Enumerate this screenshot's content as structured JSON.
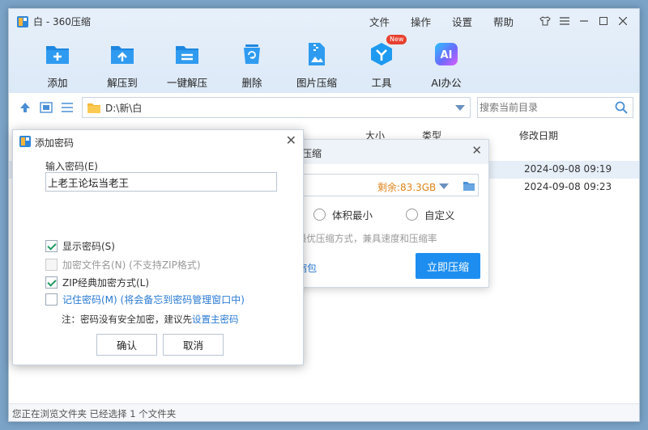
{
  "app": {
    "title": "白 - 360压缩"
  },
  "menu": [
    "文件",
    "操作",
    "设置",
    "帮助"
  ],
  "toolbar": [
    {
      "label": "添加",
      "icon": "add-file-icon"
    },
    {
      "label": "解压到",
      "icon": "extract-to-icon"
    },
    {
      "label": "一键解压",
      "icon": "one-click-extract-icon"
    },
    {
      "label": "删除",
      "icon": "delete-icon"
    },
    {
      "label": "图片压缩",
      "icon": "image-compress-icon"
    },
    {
      "label": "工具",
      "icon": "tools-icon",
      "badge": "New"
    },
    {
      "label": "AI办公",
      "icon": "ai-office-icon",
      "icon_text": "AI"
    }
  ],
  "address": {
    "path": "D:\\新\\白"
  },
  "search": {
    "placeholder": "搜索当前目录"
  },
  "columns": {
    "size": "大小",
    "type": "类型",
    "modified": "修改日期"
  },
  "files": [
    {
      "modified": "2024-09-08 09:19"
    },
    {
      "modified": "2024-09-08 09:23"
    }
  ],
  "status": {
    "text": "您正在浏览文件夹 已经选择 1 个文件夹"
  },
  "compress_dialog": {
    "title_partial": "压缩",
    "free_space": "剩余:83.3GB",
    "option_smallest": "体积最小",
    "option_custom": "自定义",
    "description": "最优压缩方式，兼具速度和压缩率",
    "link_partial": "缩包",
    "start_button": "立即压缩"
  },
  "password_dialog": {
    "title": "添加密码",
    "input_label": "输入密码(E)",
    "password_value": "上老王论坛当老王",
    "show_password": "显示密码(S)",
    "encrypt_filenames": "加密文件名(N) (不支持ZIP格式)",
    "zip_classic": "ZIP经典加密方式(L)",
    "remember_password": "记住密码(M) (将会备忘到密码管理窗口中)",
    "note_prefix": "注：密码没有安全加密，建议先",
    "note_link": "设置主密码",
    "ok": "确认",
    "cancel": "取消"
  },
  "colors": {
    "accent": "#1d8ef0",
    "free_space": "#e0841b",
    "link": "#2a7ad3",
    "check": "#1f9a62"
  }
}
